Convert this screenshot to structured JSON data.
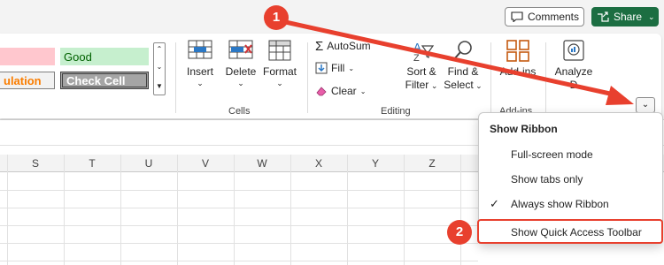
{
  "topbar": {
    "comments_label": "Comments",
    "share_label": "Share"
  },
  "styles_gallery": {
    "row1": [
      "",
      "Good"
    ],
    "row2": [
      "ulation",
      "Check Cell"
    ]
  },
  "cells_group": {
    "label": "Cells",
    "insert_label": "Insert",
    "delete_label": "Delete",
    "format_label": "Format"
  },
  "editing_group": {
    "label": "Editing",
    "autosum_label": "AutoSum",
    "fill_label": "Fill",
    "clear_label": "Clear",
    "sort_filter_line1": "Sort &",
    "sort_filter_line2": "Filter",
    "find_select_line1": "Find &",
    "find_select_line2": "Select"
  },
  "addins_group": {
    "label": "Add-ins",
    "addins_label": "Add-ins"
  },
  "analyze_group": {
    "analyze_line1": "Analyze",
    "analyze_line2": "D"
  },
  "columns": [
    "S",
    "T",
    "U",
    "V",
    "W",
    "X",
    "Y",
    "Z"
  ],
  "menu": {
    "title": "Show Ribbon",
    "items": [
      {
        "label": "Full-screen mode",
        "checked": false
      },
      {
        "label": "Show tabs only",
        "checked": false
      },
      {
        "label": "Always show Ribbon",
        "checked": true
      },
      {
        "label": "Show Quick Access Toolbar",
        "checked": false
      }
    ]
  },
  "annotations": {
    "badge1": "1",
    "badge2": "2"
  },
  "colors": {
    "accent_red": "#e8402e",
    "share_green": "#1c6e42",
    "good_fill": "#c6efce",
    "bad_fill": "#ffc7ce"
  }
}
